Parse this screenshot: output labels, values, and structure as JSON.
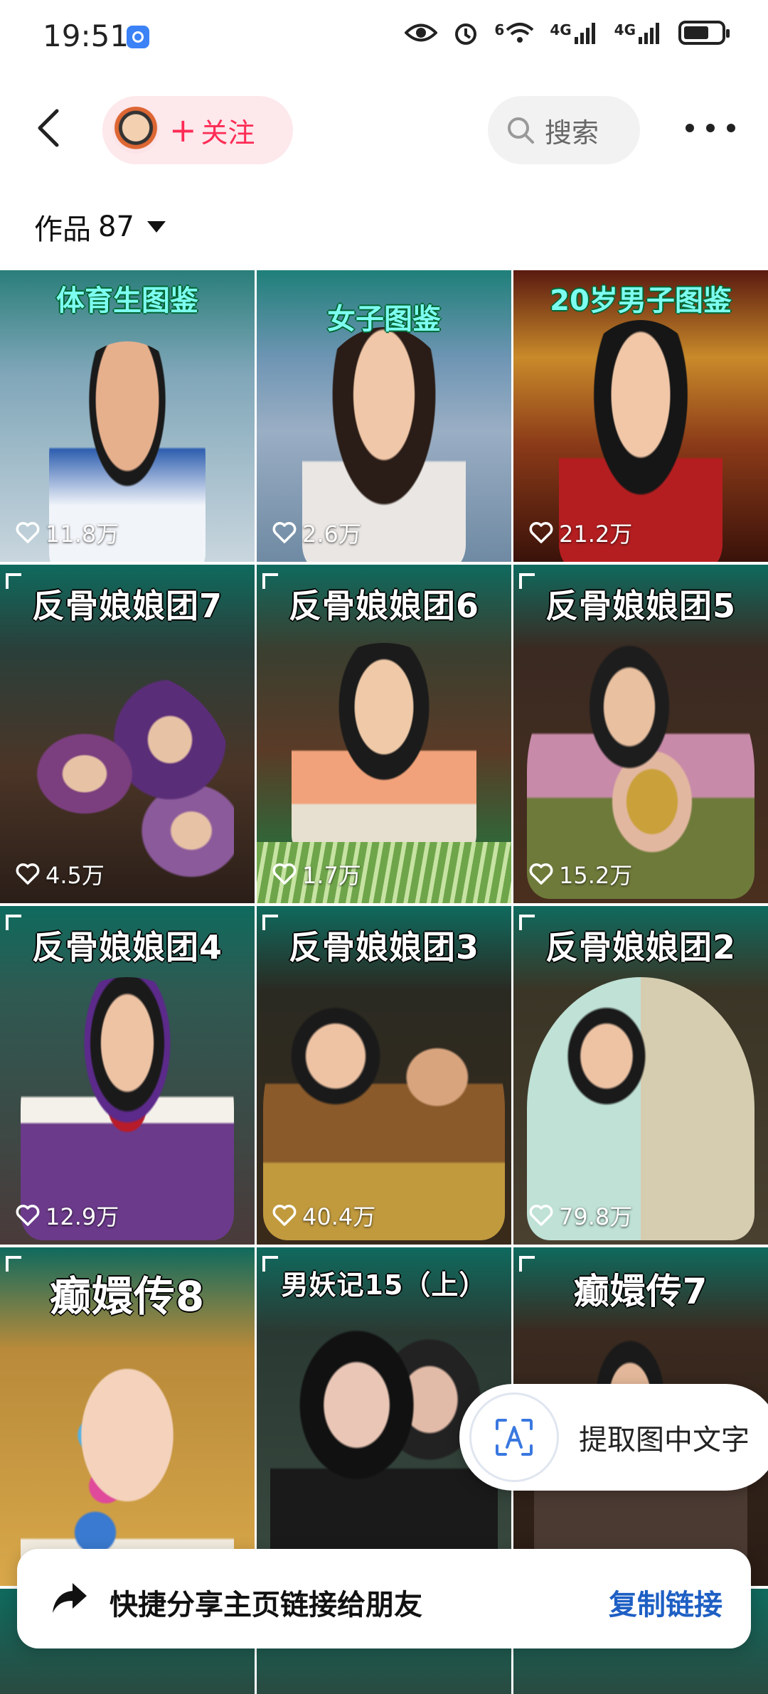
{
  "status_bar": {
    "time": "19:51",
    "network_label_1": "4G",
    "network_label_2": "4G",
    "wifi_label": "6"
  },
  "header": {
    "follow_label": "关注",
    "search_label": "搜索"
  },
  "works": {
    "label": "作品",
    "count": "87"
  },
  "tiles": [
    {
      "title": "",
      "subtitle": "体育生图鉴",
      "likes": "11.8万"
    },
    {
      "title": "",
      "subtitle": "女子图鉴",
      "likes": "2.6万"
    },
    {
      "title": "",
      "subtitle": "20岁男子图鉴",
      "likes": "21.2万"
    },
    {
      "title": "反骨娘娘团7",
      "subtitle": "",
      "likes": "4.5万"
    },
    {
      "title": "反骨娘娘团6",
      "subtitle": "",
      "likes": "1.7万"
    },
    {
      "title": "反骨娘娘团5",
      "subtitle": "",
      "likes": "15.2万"
    },
    {
      "title": "反骨娘娘团4",
      "subtitle": "",
      "likes": "12.9万"
    },
    {
      "title": "反骨娘娘团3",
      "subtitle": "",
      "likes": "40.4万"
    },
    {
      "title": "反骨娘娘团2",
      "subtitle": "",
      "likes": "79.8万"
    },
    {
      "title": "癫嬛传8",
      "subtitle": "",
      "likes": ""
    },
    {
      "title": "男妖记15（上）",
      "subtitle": "",
      "likes": ""
    },
    {
      "title": "癫嬛传7",
      "subtitle": "",
      "likes": ""
    }
  ],
  "ocr_button": {
    "label": "提取图中文字"
  },
  "share_bar": {
    "text": "快捷分享主页链接给朋友",
    "action": "复制链接"
  }
}
